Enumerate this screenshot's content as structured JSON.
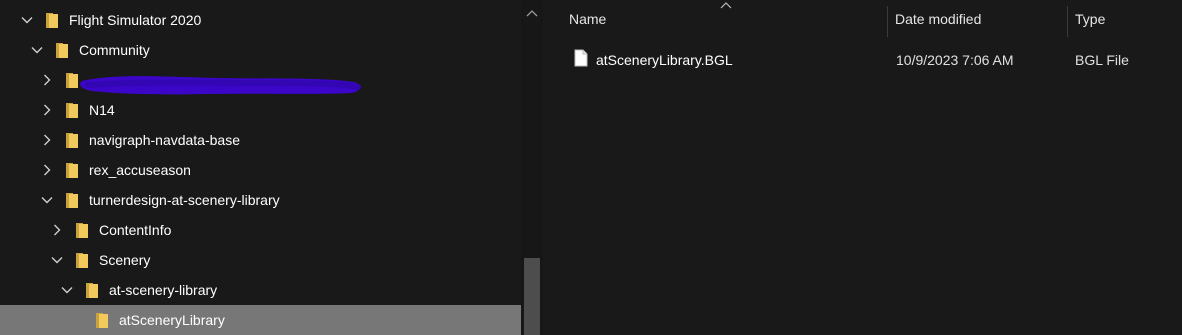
{
  "tree": {
    "items": [
      {
        "label": "Flight Simulator 2020",
        "expanded": true
      },
      {
        "label": "Community",
        "expanded": true
      },
      {
        "label": "",
        "expanded": false,
        "redacted": true
      },
      {
        "label": "N14",
        "expanded": false
      },
      {
        "label": "navigraph-navdata-base",
        "expanded": false
      },
      {
        "label": "rex_accuseason",
        "expanded": false
      },
      {
        "label": "turnerdesign-at-scenery-library",
        "expanded": true
      },
      {
        "label": "ContentInfo",
        "expanded": false
      },
      {
        "label": "Scenery",
        "expanded": true
      },
      {
        "label": "at-scenery-library",
        "expanded": true
      },
      {
        "label": "atSceneryLibrary",
        "selected": true
      }
    ]
  },
  "file_list": {
    "columns": {
      "name": "Name",
      "date_modified": "Date modified",
      "type": "Type"
    },
    "sorted_by": "Name",
    "rows": [
      {
        "name": "atSceneryLibrary.BGL",
        "date_modified": "10/9/2023 7:06 AM",
        "type": "BGL File"
      }
    ]
  },
  "icons": {
    "folder": "folder-icon",
    "file": "file-icon",
    "expanded": "chevron-down-icon",
    "collapsed": "chevron-right-icon"
  },
  "colors": {
    "background": "#191919",
    "selected_row": "#777777",
    "folder_yellow": "#f2c95c",
    "redaction_ink": "#3b06c7",
    "text": "#ffffff"
  }
}
